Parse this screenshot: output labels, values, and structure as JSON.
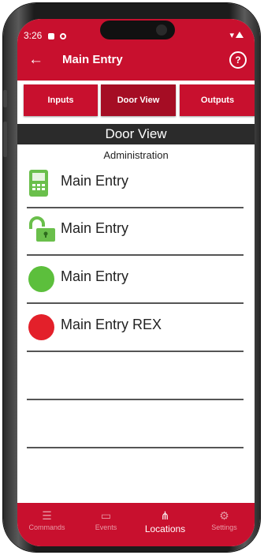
{
  "status": {
    "time": "3:26"
  },
  "appbar": {
    "back_icon": "arrow-left-icon",
    "title": "Main Entry",
    "help_icon": "help-circle-icon"
  },
  "tabs": [
    {
      "label": "Inputs"
    },
    {
      "label": "Door View"
    },
    {
      "label": "Outputs"
    }
  ],
  "section": {
    "title": "Door View",
    "subtitle": "Administration"
  },
  "rows": [
    {
      "label": "Main Entry",
      "icon": "keypad-reader-icon",
      "color": "#6abf4b"
    },
    {
      "label": "Main Entry",
      "icon": "unlocked-padlock-icon",
      "color": "#6abf4b"
    },
    {
      "label": "Main Entry",
      "icon": "green-status-dot-icon",
      "color": "#5cbf3c"
    },
    {
      "label": "Main Entry REX",
      "icon": "red-status-dot-icon",
      "color": "#e3202a"
    }
  ],
  "bottom_nav": [
    {
      "label": "Commands",
      "icon": "list-icon"
    },
    {
      "label": "Events",
      "icon": "monitor-icon"
    },
    {
      "label": "Locations",
      "icon": "network-icon"
    },
    {
      "label": "Settings",
      "icon": "gears-icon"
    }
  ],
  "colors": {
    "brand_red": "#c8102e",
    "active_tab": "#a50d24",
    "header_dark": "#2b2b2b"
  }
}
